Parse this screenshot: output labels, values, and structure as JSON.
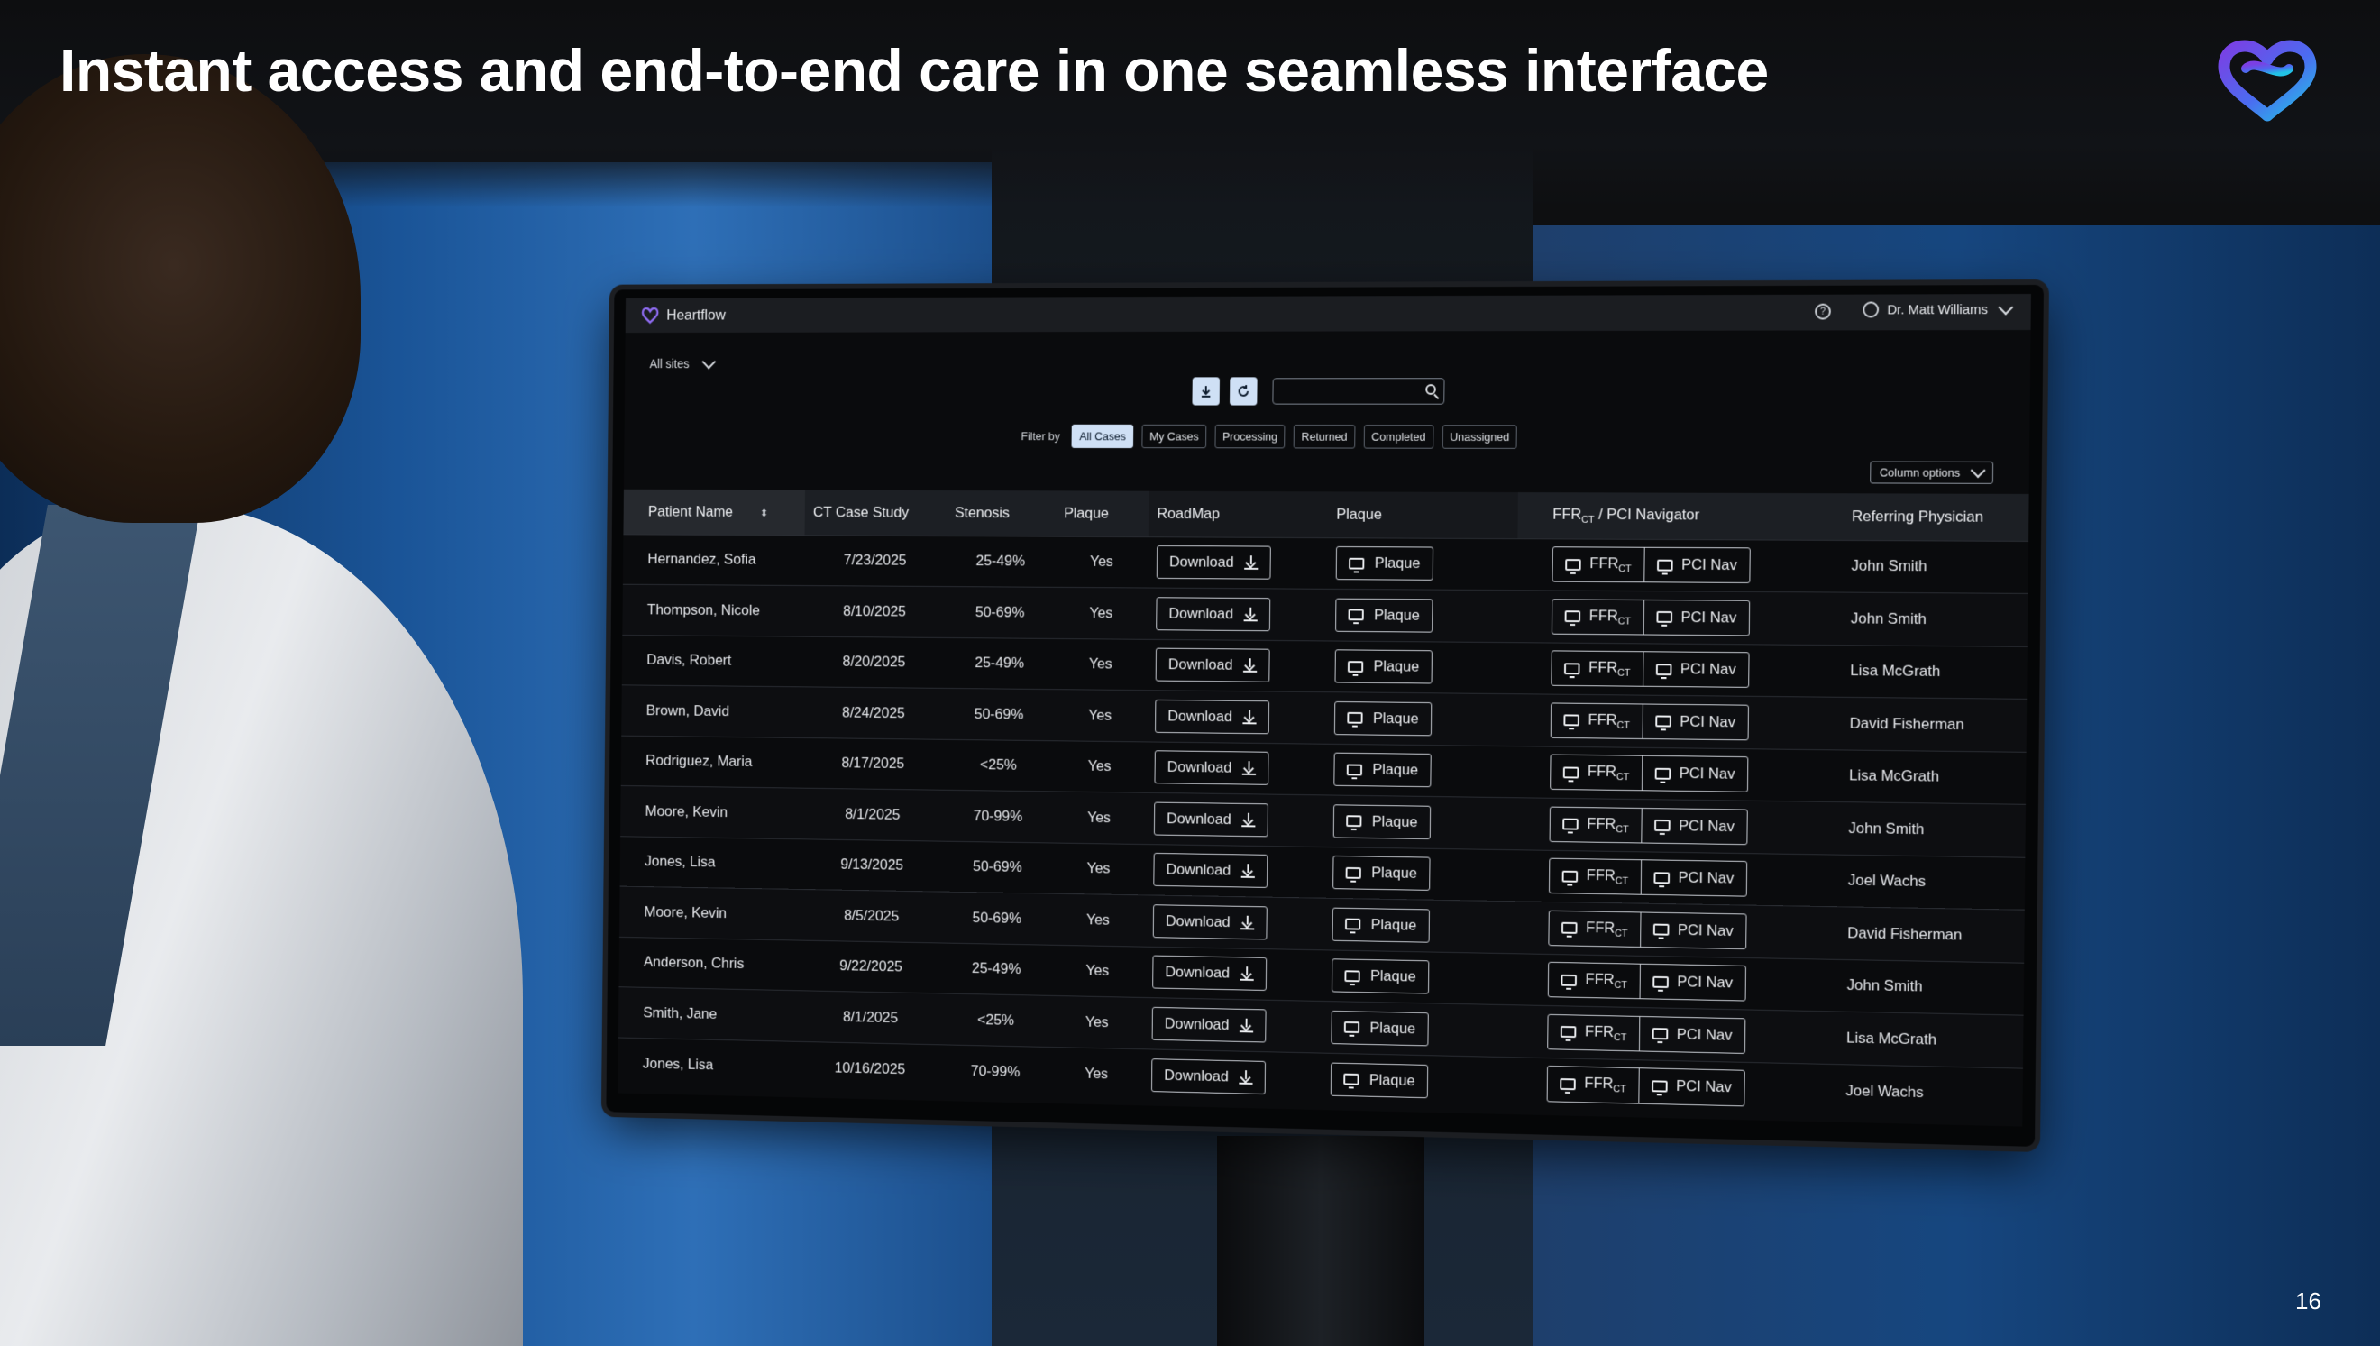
{
  "slide": {
    "title": "Instant access and end-to-end care in one seamless interface",
    "page_number": "16"
  },
  "app": {
    "name": "Heartflow",
    "user": "Dr. Matt Williams",
    "sites_label": "All sites",
    "filter_label": "Filter by",
    "filters": [
      "All Cases",
      "My Cases",
      "Processing",
      "Returned",
      "Completed",
      "Unassigned"
    ],
    "active_filter": "All Cases",
    "column_options": "Column options"
  },
  "table": {
    "headers": {
      "patient": "Patient Name",
      "ct": "CT Case Study",
      "stenosis": "Stenosis",
      "plaque": "Plaque",
      "roadmap": "RoadMap",
      "plaque2": "Plaque",
      "ffr_pre": "FFR",
      "ffr_sub": "CT",
      "ffr_post": " / PCI Navigator",
      "physician": "Referring Physician"
    },
    "buttons": {
      "download": "Download",
      "plaque": "Plaque",
      "ffr": "FFR",
      "ffr_sub": "CT",
      "pci": "PCI Nav"
    },
    "rows": [
      {
        "name": "Hernandez, Sofia",
        "date": "7/23/2025",
        "stenosis": "25-49%",
        "plaque": "Yes",
        "physician": "John Smith"
      },
      {
        "name": "Thompson, Nicole",
        "date": "8/10/2025",
        "stenosis": "50-69%",
        "plaque": "Yes",
        "physician": "John Smith"
      },
      {
        "name": "Davis, Robert",
        "date": "8/20/2025",
        "stenosis": "25-49%",
        "plaque": "Yes",
        "physician": "Lisa McGrath"
      },
      {
        "name": "Brown, David",
        "date": "8/24/2025",
        "stenosis": "50-69%",
        "plaque": "Yes",
        "physician": "David Fisherman"
      },
      {
        "name": "Rodriguez, Maria",
        "date": "8/17/2025",
        "stenosis": "<25%",
        "plaque": "Yes",
        "physician": "Lisa McGrath"
      },
      {
        "name": "Moore, Kevin",
        "date": "8/1/2025",
        "stenosis": "70-99%",
        "plaque": "Yes",
        "physician": "John Smith"
      },
      {
        "name": "Jones, Lisa",
        "date": "9/13/2025",
        "stenosis": "50-69%",
        "plaque": "Yes",
        "physician": "Joel Wachs"
      },
      {
        "name": "Moore, Kevin",
        "date": "8/5/2025",
        "stenosis": "50-69%",
        "plaque": "Yes",
        "physician": "David Fisherman"
      },
      {
        "name": "Anderson, Chris",
        "date": "9/22/2025",
        "stenosis": "25-49%",
        "plaque": "Yes",
        "physician": "John Smith"
      },
      {
        "name": "Smith, Jane",
        "date": "8/1/2025",
        "stenosis": "<25%",
        "plaque": "Yes",
        "physician": "Lisa McGrath"
      },
      {
        "name": "Jones, Lisa",
        "date": "10/16/2025",
        "stenosis": "70-99%",
        "plaque": "Yes",
        "physician": "Joel Wachs"
      }
    ]
  },
  "colors": {
    "brand_gradient_start": "#7b3fe4",
    "brand_gradient_end": "#22c3e6",
    "active_chip": "#cfe0f5"
  }
}
